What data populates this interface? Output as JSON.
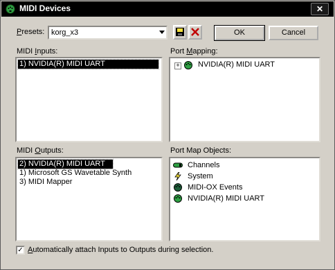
{
  "window": {
    "title": "MIDI Devices",
    "close_glyph": "✕"
  },
  "presets": {
    "label_prefix": "P",
    "label_rest": "resets:",
    "value": "korg_x3",
    "save_icon": "floppy-disk-icon",
    "delete_icon": "red-x-icon"
  },
  "buttons": {
    "ok": "OK",
    "cancel": "Cancel"
  },
  "midi_inputs": {
    "label_prefix": "MIDI ",
    "label_ul": "I",
    "label_rest": "nputs:",
    "items": [
      {
        "text": "1)  NVIDIA(R) MIDI UART",
        "selected": true
      }
    ]
  },
  "port_mapping": {
    "label_prefix": "Port ",
    "label_ul": "M",
    "label_rest": "apping:",
    "tree": [
      {
        "expander": "+",
        "text": "NVIDIA(R) MIDI UART",
        "icon": "midi-port-icon"
      }
    ]
  },
  "midi_outputs": {
    "label_prefix": "MIDI ",
    "label_ul": "O",
    "label_rest": "utputs:",
    "items": [
      {
        "text": "2)  NVIDIA(R) MIDI UART",
        "selected": true
      },
      {
        "text": "1)  Microsoft GS Wavetable Synth",
        "selected": false
      },
      {
        "text": "3)  MIDI Mapper",
        "selected": false
      }
    ]
  },
  "port_map_objects": {
    "label": "Port Map Objects:",
    "items": [
      {
        "text": "Channels",
        "icon": "channels-icon"
      },
      {
        "text": "System",
        "icon": "lightning-icon"
      },
      {
        "text": "MIDI-OX Events",
        "icon": "midi-ox-events-icon"
      },
      {
        "text": "NVIDIA(R) MIDI UART",
        "icon": "midi-port-icon"
      }
    ]
  },
  "auto_attach": {
    "checked": true,
    "check_glyph": "✓",
    "label_ul": "A",
    "label_rest": "utomatically attach Inputs to Outputs during selection."
  },
  "colors": {
    "selection": "#000000",
    "title_bar": "#000000",
    "face": "#d4d0c8",
    "icon_green": "#2ea043"
  }
}
